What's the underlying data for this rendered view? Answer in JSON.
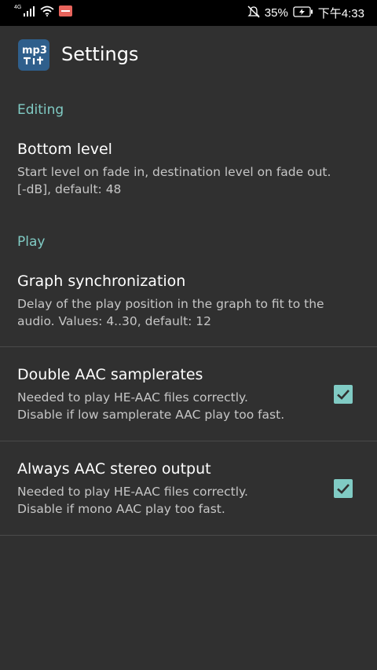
{
  "status_bar": {
    "network": "4G",
    "battery_percent": "35%",
    "time": "下午4:33",
    "icons": [
      "signal-icon",
      "wifi-icon",
      "notification-app-icon",
      "mute-icon",
      "battery-charging-icon"
    ]
  },
  "app_bar": {
    "app_icon": "mp3-cutter-app-icon",
    "title": "Settings"
  },
  "sections": {
    "editing": {
      "header": "Editing",
      "bottom_level": {
        "title": "Bottom level",
        "summary_line1": "Start level on fade in, destination level on fade out.",
        "summary_line2": "[-dB], default: 48"
      }
    },
    "play": {
      "header": "Play",
      "graph_sync": {
        "title": "Graph synchronization",
        "summary_line1": "Delay of the play position in the graph to fit to the",
        "summary_line2": "audio. Values: 4..30, default: 12"
      },
      "double_aac": {
        "title": "Double AAC samplerates",
        "summary_line1": "Needed to play HE-AAC files correctly.",
        "summary_line2": "Disable if low samplerate AAC play too fast.",
        "checked": true
      },
      "aac_stereo": {
        "title": "Always AAC stereo output",
        "summary_line1": "Needed to play HE-AAC files correctly.",
        "summary_line2": "Disable if mono AAC play too fast.",
        "checked": true
      }
    }
  },
  "colors": {
    "background": "#303030",
    "accent": "#80cbc4",
    "status_bar": "#000000",
    "divider": "#4a4a4a"
  }
}
